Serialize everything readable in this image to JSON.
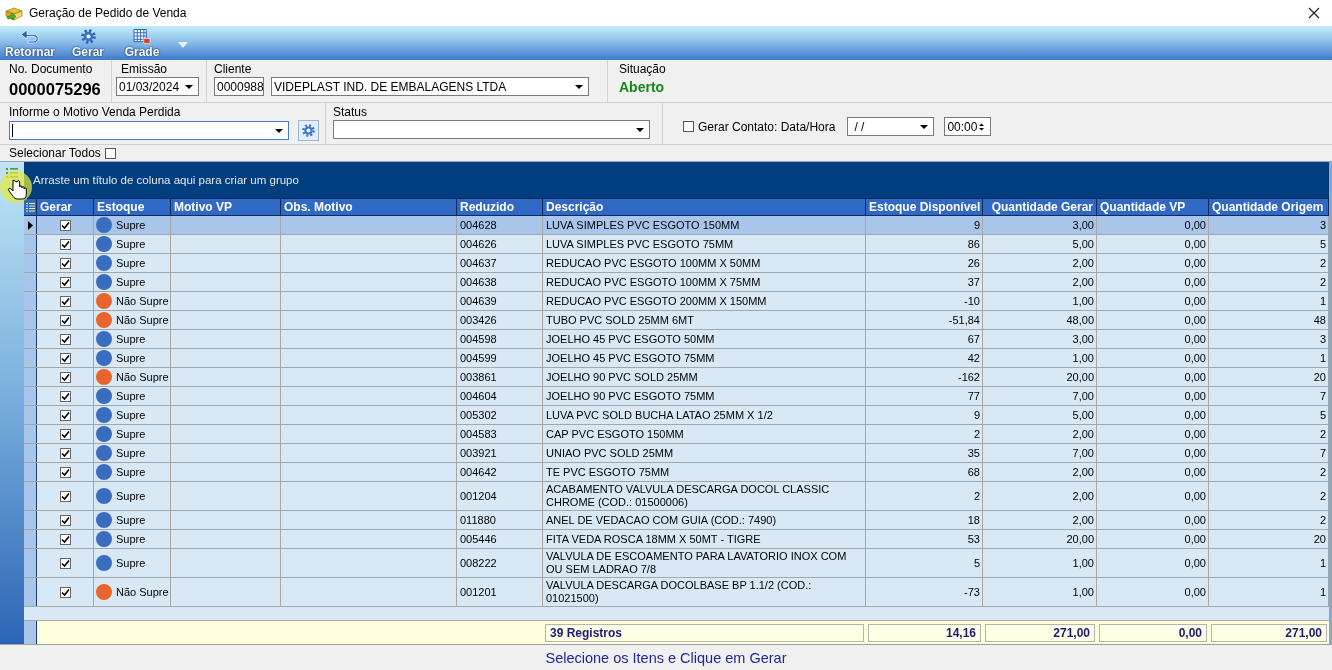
{
  "window": {
    "title": "Geração de Pedido de Venda"
  },
  "toolbar": {
    "buttons": [
      {
        "kind": "back",
        "label": "Retornar"
      },
      {
        "kind": "gear",
        "label": "Gerar"
      },
      {
        "kind": "grid",
        "label": "Grade"
      }
    ]
  },
  "header": {
    "document": {
      "label": "No. Documento",
      "value": "0000075296"
    },
    "issue_date": {
      "label": "Emissão",
      "value": "01/03/2024"
    },
    "client": {
      "label": "Cliente",
      "code": "0000988",
      "name": "VIDEPLAST IND. DE EMBALAGENS LTDA"
    },
    "situation": {
      "label": "Situação",
      "value": "Aberto"
    }
  },
  "filters": {
    "lost_sale_reason": {
      "label": "Informe o Motivo Venda Perdida",
      "focused": true
    },
    "status": {
      "label": "Status"
    },
    "contact": {
      "label": "Gerar Contato: Data/Hora",
      "checked": false,
      "date": "/ /",
      "time": "00:00"
    }
  },
  "select_all": {
    "label": "Selecionar Todos",
    "checked": false
  },
  "grid": {
    "group_hint": "Arraste um título de coluna aqui para criar um grupo",
    "columns": [
      "Gerar",
      "Estoque",
      "Motivo VP",
      "Obs. Motivo",
      "Reduzido",
      "Descrição",
      "Estoque Disponível",
      "Quantidade Gerar",
      "Quantidade VP",
      "Quantidade Origem"
    ],
    "rows": [
      {
        "selected": true,
        "gerar": true,
        "estoque": "Supre",
        "color": "#3a6cc0",
        "reduzido": "004628",
        "descricao": "LUVA SIMPLES PVC ESGOTO 150MM",
        "estoque_disponivel": "9",
        "quantidade_gerar": "3,00",
        "quantidade_vp": "0,00",
        "quantidade_origem": "3"
      },
      {
        "selected": false,
        "gerar": true,
        "estoque": "Supre",
        "color": "#3a6cc0",
        "reduzido": "004626",
        "descricao": "LUVA SIMPLES PVC ESGOTO 75MM",
        "estoque_disponivel": "86",
        "quantidade_gerar": "5,00",
        "quantidade_vp": "0,00",
        "quantidade_origem": "5"
      },
      {
        "selected": false,
        "gerar": true,
        "estoque": "Supre",
        "color": "#3a6cc0",
        "reduzido": "004637",
        "descricao": "REDUCAO PVC ESGOTO 100MM X 50MM",
        "estoque_disponivel": "26",
        "quantidade_gerar": "2,00",
        "quantidade_vp": "0,00",
        "quantidade_origem": "2"
      },
      {
        "selected": false,
        "gerar": true,
        "estoque": "Supre",
        "color": "#3a6cc0",
        "reduzido": "004638",
        "descricao": "REDUCAO PVC ESGOTO 100MM X 75MM",
        "estoque_disponivel": "37",
        "quantidade_gerar": "2,00",
        "quantidade_vp": "0,00",
        "quantidade_origem": "2"
      },
      {
        "selected": false,
        "gerar": true,
        "estoque": "Não Supre",
        "color": "#e8642c",
        "reduzido": "004639",
        "descricao": "REDUCAO PVC ESGOTO 200MM X 150MM",
        "estoque_disponivel": "-10",
        "quantidade_gerar": "1,00",
        "quantidade_vp": "0,00",
        "quantidade_origem": "1"
      },
      {
        "selected": false,
        "gerar": true,
        "estoque": "Não Supre",
        "color": "#e8642c",
        "reduzido": "003426",
        "descricao": "TUBO PVC SOLD 25MM 6MT",
        "estoque_disponivel": "-51,84",
        "quantidade_gerar": "48,00",
        "quantidade_vp": "0,00",
        "quantidade_origem": "48"
      },
      {
        "selected": false,
        "gerar": true,
        "estoque": "Supre",
        "color": "#3a6cc0",
        "reduzido": "004598",
        "descricao": "JOELHO 45 PVC ESGOTO 50MM",
        "estoque_disponivel": "67",
        "quantidade_gerar": "3,00",
        "quantidade_vp": "0,00",
        "quantidade_origem": "3"
      },
      {
        "selected": false,
        "gerar": true,
        "estoque": "Supre",
        "color": "#3a6cc0",
        "reduzido": "004599",
        "descricao": "JOELHO 45 PVC ESGOTO 75MM",
        "estoque_disponivel": "42",
        "quantidade_gerar": "1,00",
        "quantidade_vp": "0,00",
        "quantidade_origem": "1"
      },
      {
        "selected": false,
        "gerar": true,
        "estoque": "Não Supre",
        "color": "#e8642c",
        "reduzido": "003861",
        "descricao": "JOELHO 90 PVC SOLD 25MM",
        "estoque_disponivel": "-162",
        "quantidade_gerar": "20,00",
        "quantidade_vp": "0,00",
        "quantidade_origem": "20"
      },
      {
        "selected": false,
        "gerar": true,
        "estoque": "Supre",
        "color": "#3a6cc0",
        "reduzido": "004604",
        "descricao": "JOELHO 90 PVC ESGOTO 75MM",
        "estoque_disponivel": "77",
        "quantidade_gerar": "7,00",
        "quantidade_vp": "0,00",
        "quantidade_origem": "7"
      },
      {
        "selected": false,
        "gerar": true,
        "estoque": "Supre",
        "color": "#3a6cc0",
        "reduzido": "005302",
        "descricao": "LUVA PVC SOLD BUCHA LATAO 25MM X 1/2",
        "estoque_disponivel": "9",
        "quantidade_gerar": "5,00",
        "quantidade_vp": "0,00",
        "quantidade_origem": "5"
      },
      {
        "selected": false,
        "gerar": true,
        "estoque": "Supre",
        "color": "#3a6cc0",
        "reduzido": "004583",
        "descricao": "CAP PVC ESGOTO 150MM",
        "estoque_disponivel": "2",
        "quantidade_gerar": "2,00",
        "quantidade_vp": "0,00",
        "quantidade_origem": "2"
      },
      {
        "selected": false,
        "gerar": true,
        "estoque": "Supre",
        "color": "#3a6cc0",
        "reduzido": "003921",
        "descricao": "UNIAO PVC SOLD 25MM",
        "estoque_disponivel": "35",
        "quantidade_gerar": "7,00",
        "quantidade_vp": "0,00",
        "quantidade_origem": "7"
      },
      {
        "selected": false,
        "gerar": true,
        "estoque": "Supre",
        "color": "#3a6cc0",
        "reduzido": "004642",
        "descricao": "TE PVC ESGOTO 75MM",
        "estoque_disponivel": "68",
        "quantidade_gerar": "2,00",
        "quantidade_vp": "0,00",
        "quantidade_origem": "2"
      },
      {
        "selected": false,
        "gerar": true,
        "estoque": "Supre",
        "color": "#3a6cc0",
        "reduzido": "001204",
        "descricao": "ACABAMENTO VALVULA DESCARGA DOCOL CLASSIC CHROME (COD.: 01500006)",
        "estoque_disponivel": "2",
        "quantidade_gerar": "2,00",
        "quantidade_vp": "0,00",
        "quantidade_origem": "2"
      },
      {
        "selected": false,
        "gerar": true,
        "estoque": "Supre",
        "color": "#3a6cc0",
        "reduzido": "011880",
        "descricao": "ANEL DE VEDACAO COM GUIA (COD.: 7490)",
        "estoque_disponivel": "18",
        "quantidade_gerar": "2,00",
        "quantidade_vp": "0,00",
        "quantidade_origem": "2"
      },
      {
        "selected": false,
        "gerar": true,
        "estoque": "Supre",
        "color": "#3a6cc0",
        "reduzido": "005446",
        "descricao": "FITA VEDA ROSCA 18MM X 50MT - TIGRE",
        "estoque_disponivel": "53",
        "quantidade_gerar": "20,00",
        "quantidade_vp": "0,00",
        "quantidade_origem": "20"
      },
      {
        "selected": false,
        "gerar": true,
        "estoque": "Supre",
        "color": "#3a6cc0",
        "reduzido": "008222",
        "descricao": "VALVULA DE ESCOAMENTO PARA LAVATORIO INOX COM OU SEM LADRAO 7/8",
        "estoque_disponivel": "5",
        "quantidade_gerar": "1,00",
        "quantidade_vp": "0,00",
        "quantidade_origem": "1"
      },
      {
        "selected": false,
        "gerar": true,
        "estoque": "Não Supre",
        "color": "#e8642c",
        "reduzido": "001201",
        "descricao": "VALVULA DESCARGA DOCOLBASE BP 1.1/2 (COD.: 01021500)",
        "estoque_disponivel": "-73",
        "quantidade_gerar": "1,00",
        "quantidade_vp": "0,00",
        "quantidade_origem": "1"
      }
    ],
    "footer": {
      "count": "39 Registros",
      "totals": [
        "14,16",
        "271,00",
        "0,00",
        "271,00"
      ]
    }
  },
  "status_bar": {
    "message": "Selecione os Itens e Clique em Gerar"
  }
}
